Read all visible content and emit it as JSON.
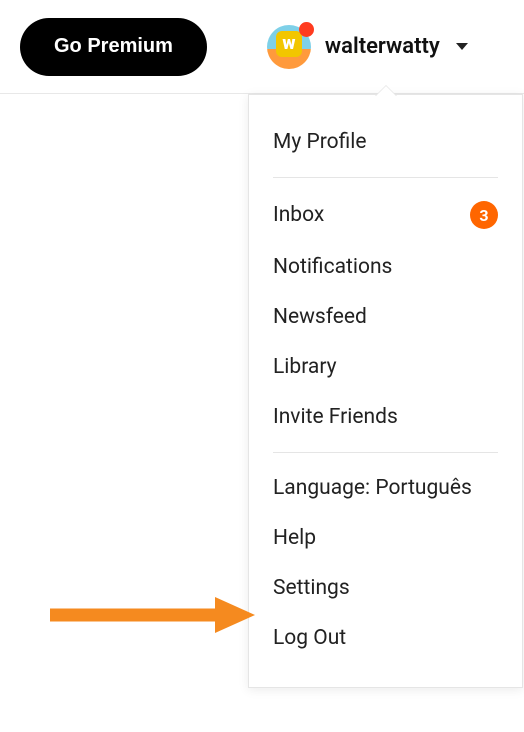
{
  "header": {
    "premium_label": "Go Premium",
    "username": "walterwatty"
  },
  "dropdown": {
    "my_profile": "My Profile",
    "inbox": "Inbox",
    "inbox_count": "3",
    "notifications": "Notifications",
    "newsfeed": "Newsfeed",
    "library": "Library",
    "invite_friends": "Invite Friends",
    "language": "Language: Português",
    "help": "Help",
    "settings": "Settings",
    "logout": "Log Out"
  },
  "colors": {
    "badge_bg": "#ff6600",
    "notification_dot": "#ff3b1f",
    "arrow": "#f58a1f"
  }
}
